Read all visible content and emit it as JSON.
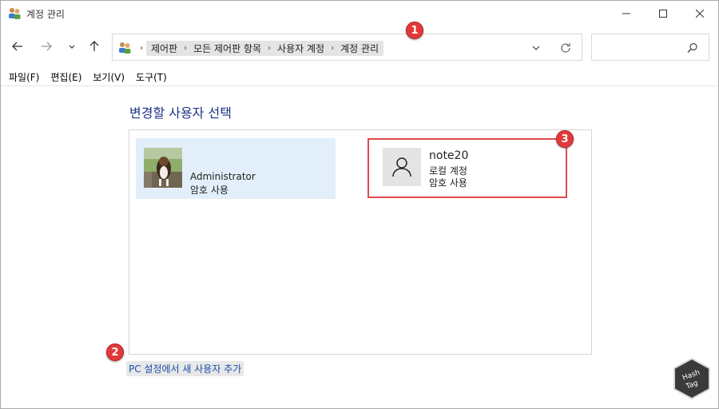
{
  "window": {
    "title": "계정 관리"
  },
  "nav": {
    "breadcrumbs": [
      "제어판",
      "모든 제어판 항목",
      "사용자 계정",
      "계정 관리"
    ],
    "search_placeholder": ""
  },
  "menu": {
    "items": [
      "파일(F)",
      "편집(E)",
      "보기(V)",
      "도구(T)"
    ]
  },
  "content": {
    "heading": "변경할 사용자 선택",
    "accounts": [
      {
        "name": "Administrator",
        "lines": [
          "암호 사용"
        ],
        "selected": true
      },
      {
        "name": "note20",
        "lines": [
          "로컬 계정",
          "암호 사용"
        ],
        "selected": false
      }
    ],
    "add_user_link": "PC 설정에서 새 사용자 추가"
  },
  "annotations": {
    "markers": [
      "1",
      "2",
      "3"
    ],
    "color": "#e23a3c"
  },
  "watermark": {
    "text": "Hash Tag"
  },
  "colors": {
    "heading": "#1e3287",
    "link": "#1a4fa8",
    "selected_account_bg": "#e2effb",
    "highlight_border": "#e0494a"
  }
}
